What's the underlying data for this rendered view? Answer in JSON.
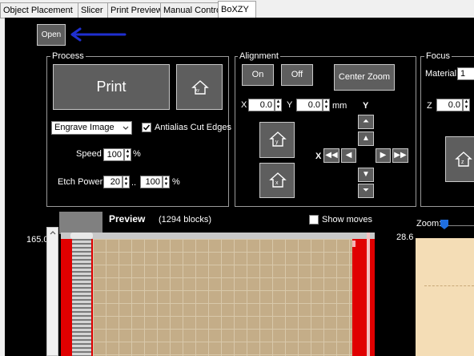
{
  "tabs": [
    {
      "label": "Object Placement"
    },
    {
      "label": "Slicer"
    },
    {
      "label": "Print Preview"
    },
    {
      "label": "Manual Control"
    },
    {
      "label": "BoXZY"
    }
  ],
  "toolbar": {
    "open_label": "Open"
  },
  "process": {
    "title": "Process",
    "print_label": "Print",
    "home_icon_text": "xy",
    "mode_select": "Engrave Image",
    "antialias_label": "Antialias Cut Edges",
    "antialias_checked": true,
    "speed_label": "Speed",
    "speed_value": "100",
    "speed_unit": "%",
    "etch_label": "Etch Power",
    "etch_min": "20",
    "etch_sep": "..",
    "etch_max": "100",
    "etch_unit": "%"
  },
  "alignment": {
    "title": "Alignment",
    "on_label": "On",
    "off_label": "Off",
    "center_zoom_label": "Center Zoom",
    "x_label": "X",
    "x_value": "0.0",
    "y_label": "Y",
    "y_value": "0.0",
    "unit": "mm",
    "y_axis_label": "Y",
    "x_axis_label": "X",
    "home_y_text": "y",
    "home_x_text": "x"
  },
  "focus": {
    "title": "Focus",
    "material_label": "Material:",
    "material_value": "1",
    "z_label": "Z",
    "z_value": "0.0",
    "home_z_text": "z"
  },
  "preview": {
    "title": "Preview",
    "blocks": "(1294 blocks)",
    "show_moves_label": "Show moves",
    "show_moves_checked": false,
    "y_max": "165.0"
  },
  "zoom": {
    "label": "Zoom:",
    "value": "28.6"
  },
  "colors": {
    "frame_red": "#e00000",
    "bed": "#c4ad88",
    "annotation_arrow": "#1f2fd0",
    "panel": "#000000",
    "button": "#5e5e5e"
  }
}
